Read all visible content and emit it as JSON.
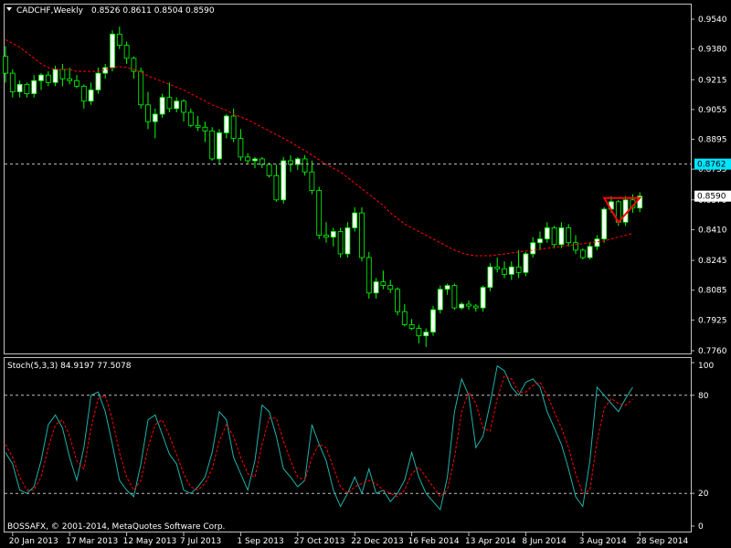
{
  "header": {
    "symbol_label": "CADCHF,Weekly",
    "ohlc": "0.8526 0.8611 0.8504 0.8590"
  },
  "footer": {
    "copyright": "BOSSAFX, © 2001-2014, MetaQuotes Software Corp."
  },
  "colors": {
    "background": "#000000",
    "frame": "#c0c0c0",
    "bullish_body": "#ffffff",
    "bearish_body": "#000000",
    "candle_outline": "#00ff00",
    "moving_average": "#ff0000",
    "stoch_main": "#20b2aa",
    "stoch_signal": "#ff0000",
    "level_line": "#c0c0c0",
    "pattern": "#ff0000",
    "price_label_bg": "#ffffff",
    "hline_label_bg": "#00e5ff"
  },
  "chart_data": [
    {
      "type": "candlestick",
      "symbol": "CADCHF",
      "timeframe": "Weekly",
      "y_ticks": [
        "0.9540",
        "0.9380",
        "0.9215",
        "0.9055",
        "0.8895",
        "0.8735",
        "0.8570",
        "0.8410",
        "0.8245",
        "0.8085",
        "0.7925",
        "0.7760"
      ],
      "ylim": [
        0.776,
        0.954
      ],
      "x_tick_labels": [
        {
          "label": "20 Jan 2013",
          "index": 1
        },
        {
          "label": "17 Mar 2013",
          "index": 9
        },
        {
          "label": "12 May 2013",
          "index": 17
        },
        {
          "label": "7 Jul 2013",
          "index": 25
        },
        {
          "label": "1 Sep 2013",
          "index": 33
        },
        {
          "label": "27 Oct 2013",
          "index": 41
        },
        {
          "label": "22 Dec 2013",
          "index": 49
        },
        {
          "label": "16 Feb 2014",
          "index": 57
        },
        {
          "label": "13 Apr 2014",
          "index": 65
        },
        {
          "label": "8 Jun 2014",
          "index": 73
        },
        {
          "label": "3 Aug 2014",
          "index": 81
        },
        {
          "label": "28 Sep 2014",
          "index": 89
        }
      ],
      "candles": [
        [
          0.934,
          0.9395,
          0.92,
          0.925
        ],
        [
          0.925,
          0.927,
          0.912,
          0.915
        ],
        [
          0.915,
          0.921,
          0.912,
          0.919
        ],
        [
          0.919,
          0.92,
          0.912,
          0.914
        ],
        [
          0.914,
          0.924,
          0.912,
          0.921
        ],
        [
          0.921,
          0.925,
          0.916,
          0.924
        ],
        [
          0.924,
          0.926,
          0.918,
          0.92
        ],
        [
          0.92,
          0.929,
          0.918,
          0.927
        ],
        [
          0.927,
          0.93,
          0.918,
          0.922
        ],
        [
          0.922,
          0.928,
          0.919,
          0.921
        ],
        [
          0.921,
          0.924,
          0.917,
          0.918
        ],
        [
          0.918,
          0.919,
          0.906,
          0.91
        ],
        [
          0.91,
          0.92,
          0.908,
          0.916
        ],
        [
          0.916,
          0.928,
          0.914,
          0.925
        ],
        [
          0.925,
          0.93,
          0.922,
          0.928
        ],
        [
          0.928,
          0.948,
          0.926,
          0.946
        ],
        [
          0.946,
          0.95,
          0.938,
          0.94
        ],
        [
          0.94,
          0.942,
          0.93,
          0.933
        ],
        [
          0.933,
          0.934,
          0.922,
          0.926
        ],
        [
          0.926,
          0.928,
          0.906,
          0.908
        ],
        [
          0.908,
          0.915,
          0.895,
          0.899
        ],
        [
          0.899,
          0.906,
          0.89,
          0.903
        ],
        [
          0.903,
          0.914,
          0.901,
          0.912
        ],
        [
          0.912,
          0.92,
          0.904,
          0.906
        ],
        [
          0.906,
          0.912,
          0.904,
          0.91
        ],
        [
          0.91,
          0.911,
          0.899,
          0.904
        ],
        [
          0.904,
          0.906,
          0.896,
          0.897
        ],
        [
          0.897,
          0.902,
          0.894,
          0.896
        ],
        [
          0.896,
          0.899,
          0.888,
          0.894
        ],
        [
          0.894,
          0.896,
          0.878,
          0.879
        ],
        [
          0.879,
          0.895,
          0.876,
          0.893
        ],
        [
          0.893,
          0.903,
          0.89,
          0.902
        ],
        [
          0.902,
          0.906,
          0.888,
          0.89
        ],
        [
          0.89,
          0.895,
          0.878,
          0.88
        ],
        [
          0.88,
          0.882,
          0.876,
          0.878
        ],
        [
          0.878,
          0.88,
          0.874,
          0.879
        ],
        [
          0.879,
          0.88,
          0.874,
          0.876
        ],
        [
          0.876,
          0.877,
          0.869,
          0.87
        ],
        [
          0.87,
          0.876,
          0.856,
          0.857
        ],
        [
          0.857,
          0.88,
          0.855,
          0.878
        ],
        [
          0.878,
          0.881,
          0.872,
          0.876
        ],
        [
          0.876,
          0.88,
          0.873,
          0.879
        ],
        [
          0.879,
          0.881,
          0.87,
          0.872
        ],
        [
          0.872,
          0.878,
          0.86,
          0.862
        ],
        [
          0.862,
          0.864,
          0.836,
          0.838
        ],
        [
          0.838,
          0.845,
          0.834,
          0.837
        ],
        [
          0.837,
          0.842,
          0.832,
          0.84
        ],
        [
          0.84,
          0.842,
          0.826,
          0.828
        ],
        [
          0.828,
          0.845,
          0.826,
          0.842
        ],
        [
          0.842,
          0.853,
          0.84,
          0.85
        ],
        [
          0.85,
          0.853,
          0.824,
          0.826
        ],
        [
          0.826,
          0.829,
          0.804,
          0.807
        ],
        [
          0.807,
          0.815,
          0.804,
          0.813
        ],
        [
          0.813,
          0.819,
          0.809,
          0.811
        ],
        [
          0.811,
          0.814,
          0.807,
          0.809
        ],
        [
          0.809,
          0.81,
          0.795,
          0.797
        ],
        [
          0.797,
          0.801,
          0.789,
          0.79
        ],
        [
          0.79,
          0.793,
          0.787,
          0.788
        ],
        [
          0.788,
          0.79,
          0.78,
          0.784
        ],
        [
          0.784,
          0.788,
          0.778,
          0.786
        ],
        [
          0.786,
          0.8,
          0.784,
          0.798
        ],
        [
          0.798,
          0.811,
          0.796,
          0.809
        ],
        [
          0.809,
          0.812,
          0.806,
          0.811
        ],
        [
          0.811,
          0.812,
          0.798,
          0.799
        ],
        [
          0.799,
          0.802,
          0.798,
          0.801
        ],
        [
          0.801,
          0.803,
          0.798,
          0.8
        ],
        [
          0.8,
          0.801,
          0.797,
          0.799
        ],
        [
          0.799,
          0.811,
          0.797,
          0.81
        ],
        [
          0.81,
          0.823,
          0.808,
          0.821
        ],
        [
          0.821,
          0.826,
          0.818,
          0.82
        ],
        [
          0.82,
          0.824,
          0.815,
          0.817
        ],
        [
          0.817,
          0.824,
          0.814,
          0.821
        ],
        [
          0.821,
          0.83,
          0.815,
          0.818
        ],
        [
          0.818,
          0.829,
          0.816,
          0.828
        ],
        [
          0.828,
          0.837,
          0.826,
          0.834
        ],
        [
          0.834,
          0.84,
          0.83,
          0.836
        ],
        [
          0.836,
          0.845,
          0.834,
          0.842
        ],
        [
          0.842,
          0.843,
          0.831,
          0.833
        ],
        [
          0.833,
          0.845,
          0.831,
          0.842
        ],
        [
          0.842,
          0.844,
          0.832,
          0.834
        ],
        [
          0.834,
          0.838,
          0.828,
          0.83
        ],
        [
          0.83,
          0.831,
          0.825,
          0.826
        ],
        [
          0.826,
          0.834,
          0.825,
          0.832
        ],
        [
          0.832,
          0.838,
          0.83,
          0.836
        ],
        [
          0.836,
          0.853,
          0.834,
          0.852
        ],
        [
          0.852,
          0.859,
          0.85,
          0.856
        ],
        [
          0.856,
          0.857,
          0.843,
          0.845
        ],
        [
          0.845,
          0.859,
          0.843,
          0.857
        ],
        [
          0.857,
          0.86,
          0.85,
          0.8526
        ],
        [
          0.8526,
          0.8611,
          0.8504,
          0.859
        ]
      ],
      "moving_average": [
        0.943,
        0.941,
        0.939,
        0.936,
        0.933,
        0.93,
        0.928,
        0.927,
        0.927,
        0.927,
        0.926,
        0.926,
        0.926,
        0.926,
        0.927,
        0.928,
        0.9285,
        0.928,
        0.927,
        0.9255,
        0.9235,
        0.922,
        0.9205,
        0.919,
        0.9175,
        0.916,
        0.914,
        0.912,
        0.91,
        0.908,
        0.9065,
        0.905,
        0.903,
        0.9015,
        0.9,
        0.898,
        0.896,
        0.894,
        0.892,
        0.89,
        0.888,
        0.8855,
        0.8835,
        0.881,
        0.8785,
        0.876,
        0.874,
        0.872,
        0.869,
        0.866,
        0.863,
        0.86,
        0.857,
        0.854,
        0.85,
        0.847,
        0.844,
        0.842,
        0.84,
        0.838,
        0.836,
        0.834,
        0.832,
        0.83,
        0.8285,
        0.8275,
        0.827,
        0.827,
        0.827,
        0.8275,
        0.828,
        0.8285,
        0.829,
        0.8295,
        0.83,
        0.8305,
        0.831,
        0.8315,
        0.832,
        0.8325,
        0.833,
        0.8335,
        0.834,
        0.8345,
        0.835,
        0.836,
        0.837,
        0.838,
        0.839
      ],
      "horizontal_line": {
        "value": 0.8762,
        "label": "0.8762"
      },
      "current_price": {
        "value": 0.859,
        "label": "0.8590"
      },
      "triangle_pattern": {
        "points": [
          {
            "index": 84,
            "price": 0.858
          },
          {
            "index": 89,
            "price": 0.858
          },
          {
            "index": 86,
            "price": 0.845
          }
        ]
      }
    },
    {
      "type": "line",
      "title": "Stoch(5,3,3) 84.9197 77.5078",
      "ylim": [
        0,
        100
      ],
      "y_ticks": [
        "100",
        "80",
        "20",
        "0"
      ],
      "levels": [
        80,
        20
      ],
      "series": [
        {
          "role": "main",
          "values": [
            45,
            38,
            22,
            20,
            24,
            40,
            62,
            68,
            60,
            42,
            28,
            48,
            80,
            82,
            70,
            50,
            28,
            22,
            18,
            38,
            65,
            68,
            56,
            44,
            38,
            22,
            20,
            24,
            30,
            45,
            70,
            65,
            42,
            32,
            22,
            40,
            74,
            70,
            55,
            35,
            30,
            24,
            28,
            62,
            50,
            40,
            22,
            12,
            20,
            30,
            20,
            35,
            20,
            22,
            15,
            20,
            28,
            45,
            30,
            20,
            15,
            10,
            30,
            70,
            90,
            80,
            48,
            55,
            75,
            98,
            95,
            85,
            80,
            88,
            90,
            85,
            70,
            60,
            50,
            35,
            18,
            12,
            40,
            85,
            80,
            75,
            70,
            78,
            84.9197
          ]
        },
        {
          "role": "signal",
          "values": [
            50,
            42,
            30,
            22,
            22,
            30,
            48,
            62,
            65,
            55,
            40,
            35,
            60,
            78,
            80,
            65,
            45,
            30,
            22,
            28,
            48,
            62,
            65,
            55,
            44,
            32,
            24,
            22,
            26,
            35,
            52,
            62,
            55,
            42,
            32,
            30,
            50,
            66,
            66,
            52,
            40,
            30,
            28,
            42,
            50,
            48,
            36,
            24,
            20,
            24,
            26,
            28,
            26,
            22,
            20,
            18,
            22,
            32,
            36,
            30,
            24,
            18,
            22,
            42,
            70,
            82,
            75,
            60,
            58,
            78,
            92,
            90,
            82,
            82,
            86,
            88,
            80,
            70,
            60,
            48,
            32,
            20,
            22,
            52,
            72,
            78,
            75,
            74,
            77.5078
          ]
        }
      ]
    }
  ]
}
